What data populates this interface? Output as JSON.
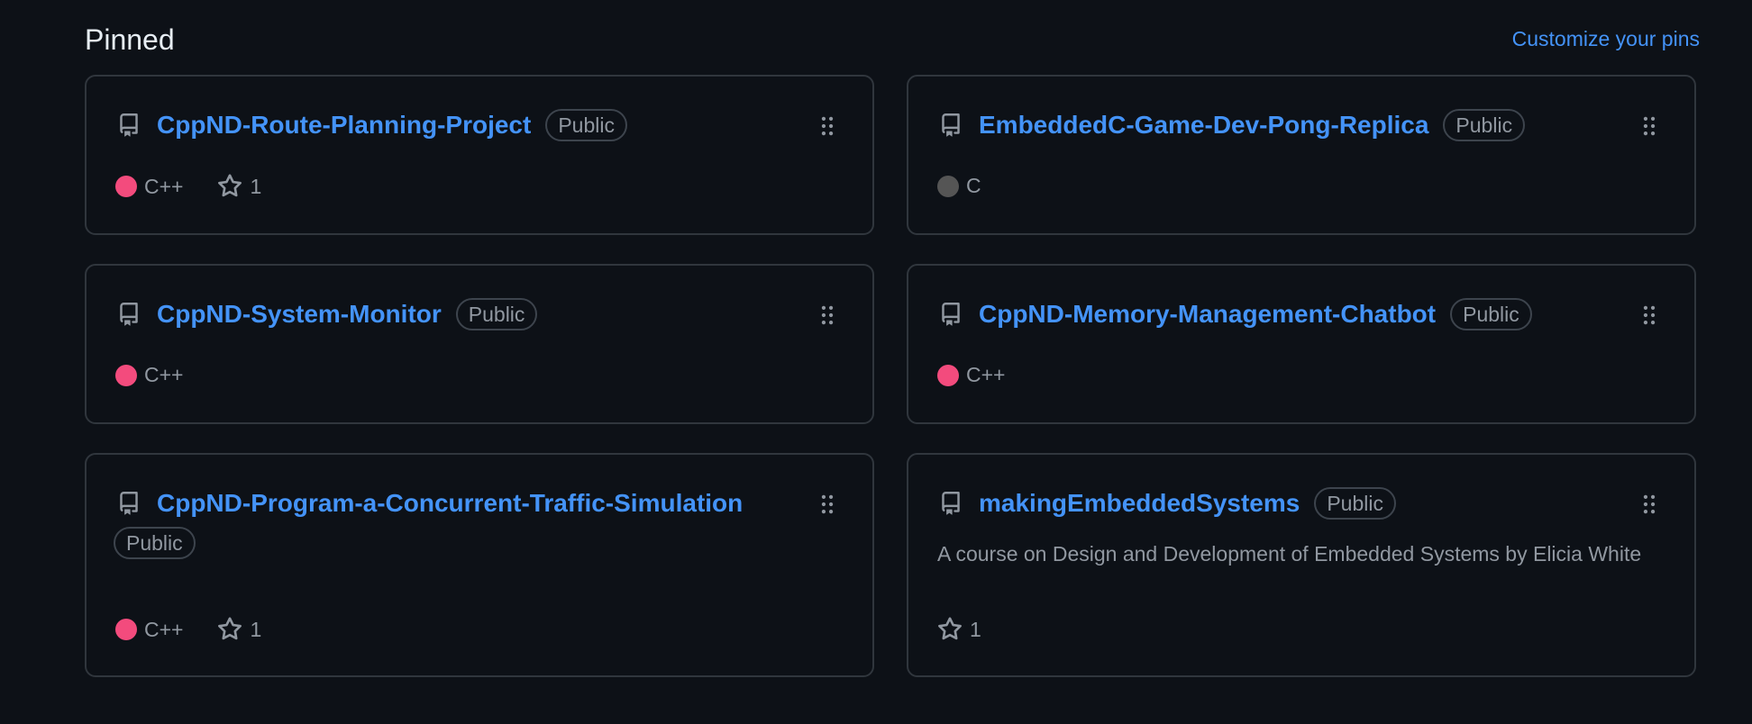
{
  "header": {
    "title": "Pinned",
    "customize_label": "Customize your pins"
  },
  "colors": {
    "link": "#4493f8",
    "cpp": "#f34b7d",
    "c": "#555555",
    "muted": "#9198a1",
    "border": "#30363d",
    "background": "#0d1117"
  },
  "cards": [
    {
      "name": "CppND-Route-Planning-Project",
      "visibility": "Public",
      "language": "C++",
      "language_color": "#f34b7d",
      "stars": "1",
      "description": ""
    },
    {
      "name": "EmbeddedC-Game-Dev-Pong-Replica",
      "visibility": "Public",
      "language": "C",
      "language_color": "#555555",
      "stars": "",
      "description": ""
    },
    {
      "name": "CppND-System-Monitor",
      "visibility": "Public",
      "language": "C++",
      "language_color": "#f34b7d",
      "stars": "",
      "description": ""
    },
    {
      "name": "CppND-Memory-Management-Chatbot",
      "visibility": "Public",
      "language": "C++",
      "language_color": "#f34b7d",
      "stars": "",
      "description": ""
    },
    {
      "name": "CppND-Program-a-Concurrent-Traffic-Simulation",
      "visibility": "Public",
      "language": "C++",
      "language_color": "#f34b7d",
      "stars": "1",
      "description": ""
    },
    {
      "name": "makingEmbeddedSystems",
      "visibility": "Public",
      "language": "",
      "language_color": "",
      "stars": "1",
      "description": "A course on Design and Development of Embedded Systems by Elicia White"
    }
  ],
  "icons": {
    "repo": "repo-icon",
    "star": "star-icon",
    "drag": "grabber-icon"
  }
}
